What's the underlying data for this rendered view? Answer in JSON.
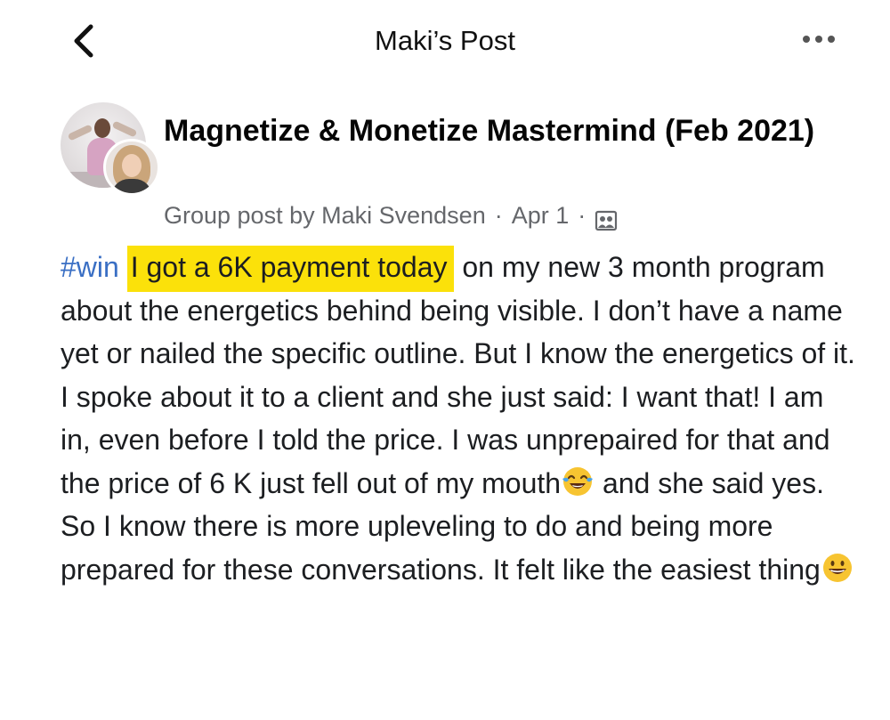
{
  "header": {
    "title": "Maki’s Post"
  },
  "post": {
    "group_name": "Magnetize & Monetize Mastermind (Feb 2021)",
    "meta": {
      "prefix": "Group post by ",
      "author": "Maki Svendsen",
      "separator": "·",
      "date": "Apr 1",
      "privacy_icon": "members-group-icon"
    },
    "body": {
      "hashtag": "#win",
      "highlighted": "I got a 6K payment today",
      "text_1": "on my new 3 month program about the energetics behind being visible. I don’t have a name yet or nailed the specific outline. But I know the energetics of it. I spoke about it to a client and she just said: I want that! I am in, even before I told the price. I was unprepaired for that and the price of 6 K just fell out of my mouth",
      "emoji_1": "face-with-tears-of-joy",
      "text_2": " and she said yes. So I know there is more upleveling to do and being more prepared for these conversations. It felt like the easiest thing",
      "emoji_2": "grinning-face"
    }
  },
  "colors": {
    "highlight": "#fbe10a",
    "hashtag": "#3a6fc4",
    "meta_text": "#65676b",
    "body_text": "#1c1e21"
  }
}
